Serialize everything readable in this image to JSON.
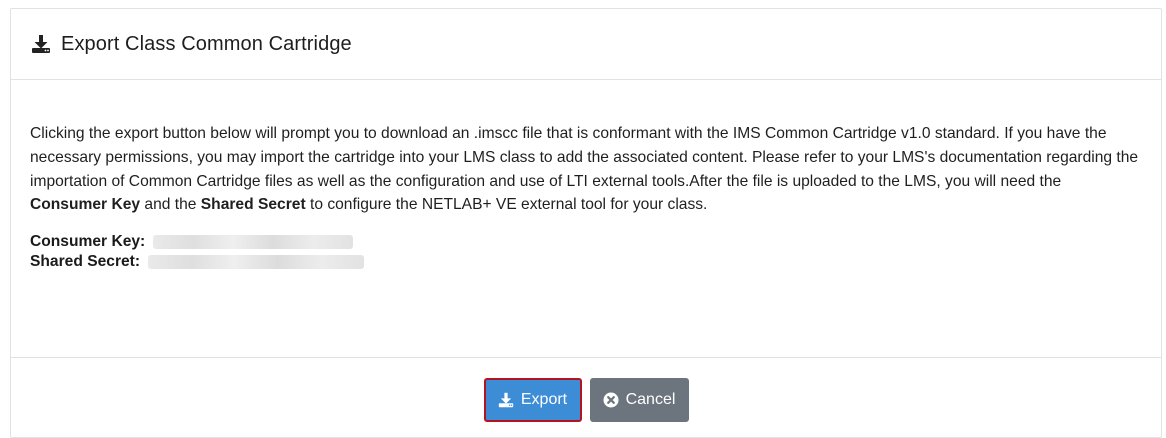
{
  "header": {
    "icon": "download-icon",
    "title": "Export Class Common Cartridge"
  },
  "body": {
    "text_1": "Clicking the export button below will prompt you to download an .imscc file that is conformant with the IMS Common Cartridge v1.0 standard. If you have the necessary permissions, you may import the cartridge into your LMS class to add the associated content. Please refer to your LMS's documentation regarding the importation of Common Cartridge files as well as the configuration and use of LTI external tools.After the file is uploaded to the LMS, you will need the ",
    "bold_1": "Consumer Key",
    "text_2": " and the ",
    "bold_2": "Shared Secret",
    "text_3": " to configure the NETLAB+ VE external tool for your class.",
    "consumer_key_label": "Consumer Key:",
    "shared_secret_label": "Shared Secret:"
  },
  "footer": {
    "export_label": "Export",
    "export_icon": "download-icon",
    "cancel_label": "Cancel",
    "cancel_icon": "times-circle-icon"
  },
  "colors": {
    "export_button": "#3c8dd6",
    "export_button_outline": "#b3141f",
    "cancel_button": "#6c757d",
    "border": "#dfe3e6"
  }
}
